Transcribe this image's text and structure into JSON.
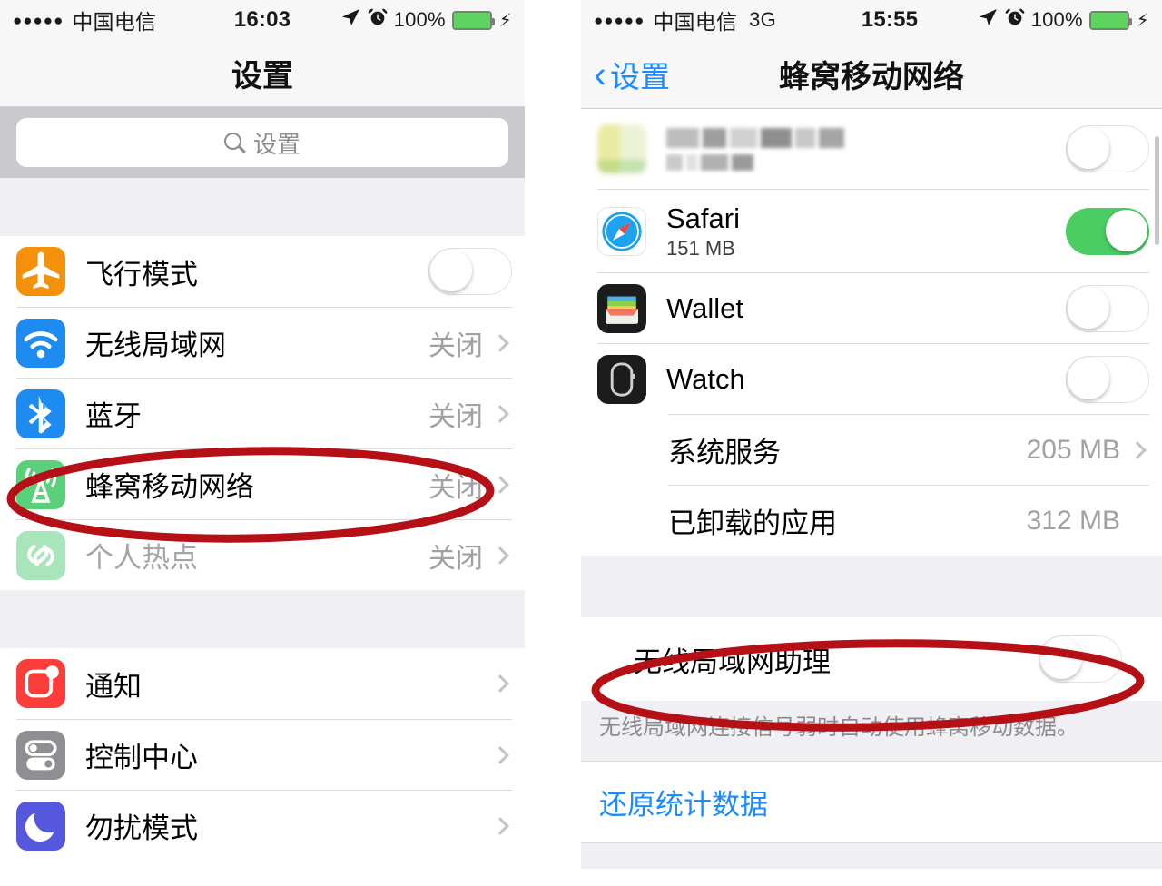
{
  "left_screen": {
    "status_bar": {
      "signal_dots": "●●●●●",
      "carrier": "中国电信",
      "network": "",
      "time": "16:03",
      "location_icon": "location-arrow-icon",
      "alarm_icon": "alarm-clock-icon",
      "battery_percent": "100%",
      "charging_icon": "lightning-bolt-icon"
    },
    "title": "设置",
    "search": {
      "placeholder": "设置",
      "icon": "search-icon"
    },
    "groups": [
      {
        "rows": [
          {
            "label": "飞行模式",
            "icon": "airplane-icon",
            "icon_color": "#f4910b",
            "control": "toggle",
            "toggle_on": false
          },
          {
            "label": "无线局域网",
            "icon": "wifi-icon",
            "icon_color": "#1e8bf0",
            "control": "value",
            "value": "关闭"
          },
          {
            "label": "蓝牙",
            "icon": "bluetooth-icon",
            "icon_color": "#1e8bf0",
            "control": "value",
            "value": "关闭"
          },
          {
            "label": "蜂窝移动网络",
            "icon": "cellular-antenna-icon",
            "icon_color": "#5bd07a",
            "control": "value",
            "value": "关闭",
            "annotated": true
          },
          {
            "label": "个人热点",
            "icon": "personal-hotspot-icon",
            "icon_color": "#a9e5ba",
            "control": "value",
            "value": "关闭",
            "dimmed": true
          }
        ]
      },
      {
        "rows": [
          {
            "label": "通知",
            "icon": "notifications-icon",
            "icon_color": "#fc3d39",
            "control": "chevron"
          },
          {
            "label": "控制中心",
            "icon": "control-center-icon",
            "icon_color": "#8e8e93",
            "control": "chevron"
          },
          {
            "label": "勿扰模式",
            "icon": "do-not-disturb-icon",
            "icon_color": "#5558dd",
            "control": "chevron"
          }
        ]
      }
    ]
  },
  "right_screen": {
    "status_bar": {
      "signal_dots": "●●●●●",
      "carrier": "中国电信",
      "network": "3G",
      "time": "15:55",
      "location_icon": "location-arrow-icon",
      "alarm_icon": "alarm-clock-icon",
      "battery_percent": "100%",
      "charging_icon": "lightning-bolt-icon"
    },
    "nav": {
      "back_label": "设置",
      "back_icon": "chevron-left-icon",
      "title": "蜂窝移动网络"
    },
    "app_rows": [
      {
        "label": "",
        "blurred": true,
        "icon": "blurred-app-icon",
        "control": "toggle",
        "toggle_on": false
      },
      {
        "label": "Safari",
        "sublabel": "151 MB",
        "icon": "safari-icon",
        "control": "toggle",
        "toggle_on": true
      },
      {
        "label": "Wallet",
        "icon": "wallet-icon",
        "control": "toggle",
        "toggle_on": false
      },
      {
        "label": "Watch",
        "icon": "watch-icon",
        "control": "toggle",
        "toggle_on": false
      },
      {
        "label": "系统服务",
        "value": "205 MB",
        "control": "chevron-value"
      },
      {
        "label": "已卸载的应用",
        "value": "312 MB",
        "control": "value"
      }
    ],
    "wifi_assist": {
      "label": "无线局域网助理",
      "toggle_on": false,
      "annotated": true,
      "footnote": "无线局域网连接信号弱时自动使用蜂窝移动数据。"
    },
    "reset_link": "还原统计数据"
  },
  "annotations": {
    "color": "#b41015",
    "shapes": [
      "ellipse-around-cellular-row",
      "ellipse-around-wifi-assist-row"
    ]
  }
}
